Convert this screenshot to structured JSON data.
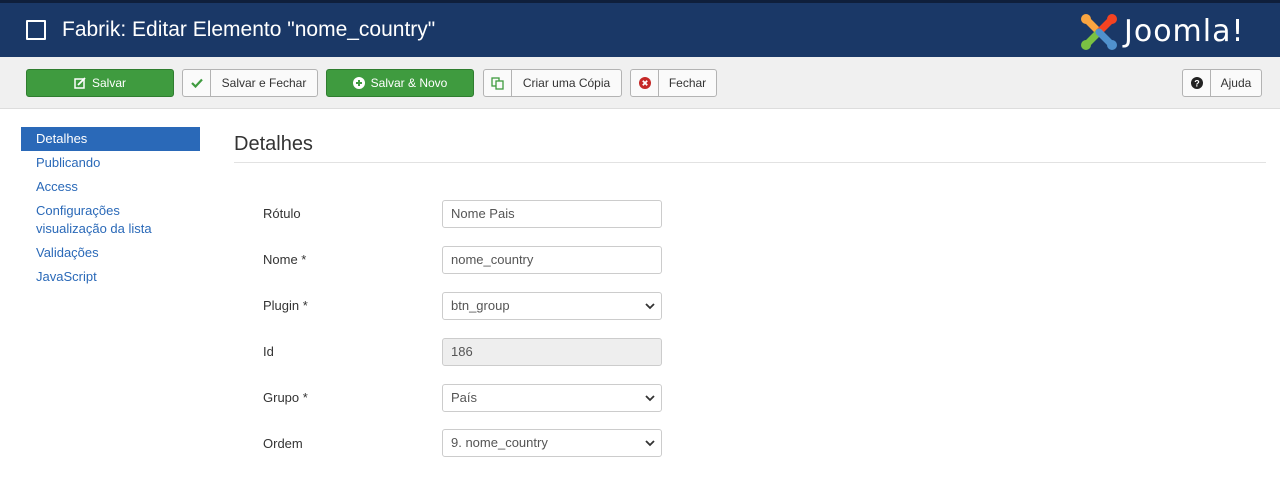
{
  "header": {
    "title": "Fabrik: Editar Elemento \"nome_country\"",
    "logo_text": "Joomla!",
    "logo_colors": [
      "#f9a541",
      "#f44321",
      "#5091cd",
      "#7ac143"
    ],
    "background": "#1a3867"
  },
  "toolbar": {
    "save_label": "Salvar",
    "save_close_label": "Salvar e Fechar",
    "save_new_label": "Salvar & Novo",
    "copy_label": "Criar uma Cópia",
    "close_label": "Fechar",
    "help_label": "Ajuda",
    "success_color": "#3f9b3f"
  },
  "sidebar": {
    "items": [
      {
        "label": "Detalhes",
        "active": true
      },
      {
        "label": "Publicando"
      },
      {
        "label": "Access"
      },
      {
        "label": "Configurações visualização da lista"
      },
      {
        "label": "Validações"
      },
      {
        "label": "JavaScript"
      }
    ]
  },
  "main": {
    "section_title": "Detalhes",
    "fields": {
      "rotulo": {
        "label": "Rótulo",
        "value": "Nome Pais"
      },
      "nome": {
        "label": "Nome *",
        "value": "nome_country"
      },
      "plugin": {
        "label": "Plugin *",
        "value": "btn_group"
      },
      "id": {
        "label": "Id",
        "value": "186"
      },
      "grupo": {
        "label": "Grupo *",
        "value": "País"
      },
      "ordem": {
        "label": "Ordem",
        "value": "9. nome_country"
      }
    }
  }
}
